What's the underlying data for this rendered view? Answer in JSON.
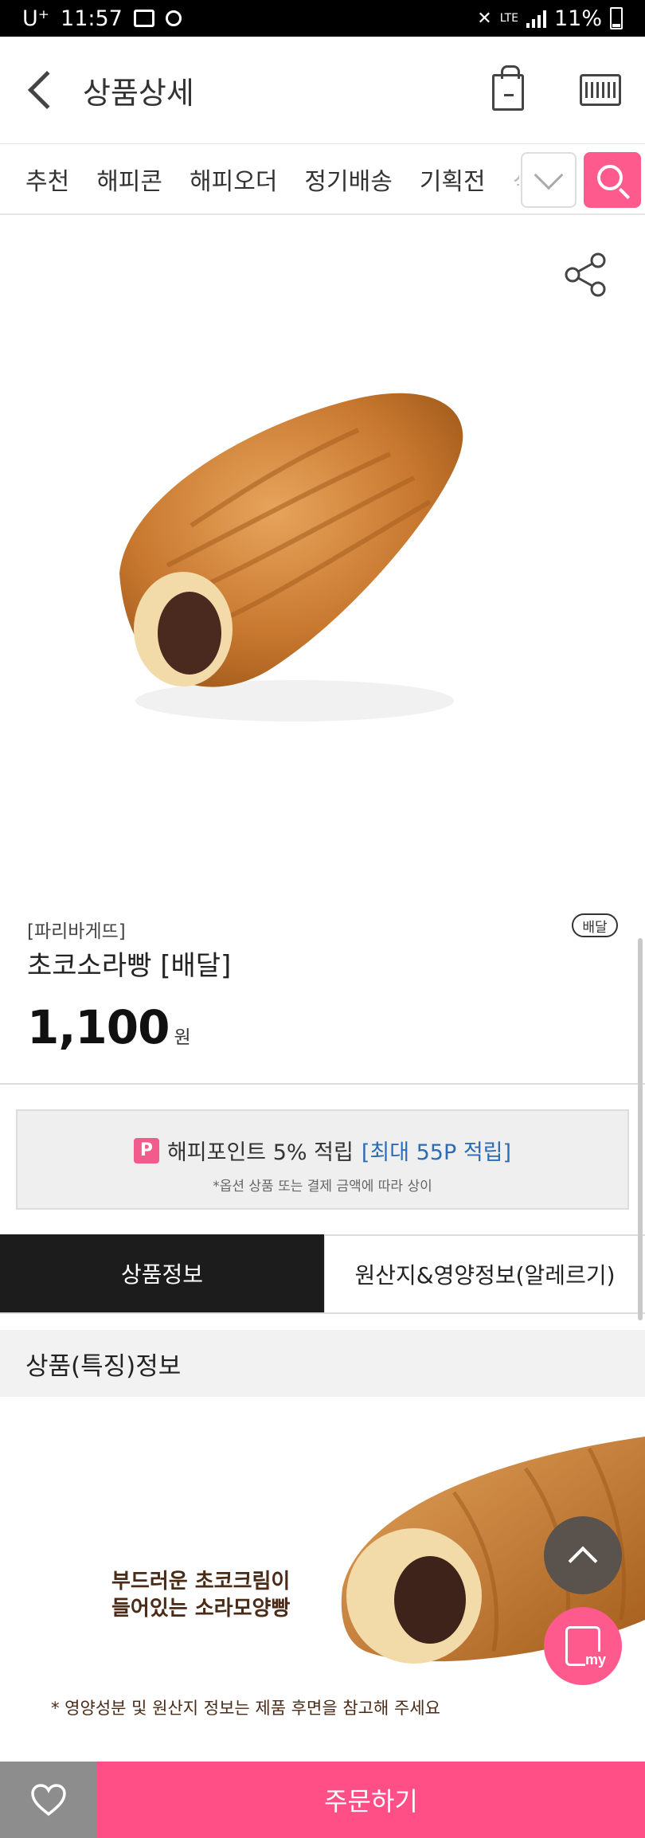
{
  "status_bar": {
    "carrier": "U⁺",
    "time": "11:57",
    "network": "LTE",
    "battery": "11%"
  },
  "header": {
    "title": "상품상세",
    "icons": [
      "back-icon",
      "shopping-bag-icon",
      "barcode-icon"
    ]
  },
  "category_nav": {
    "items": [
      "추천",
      "해피콘",
      "해피오더",
      "정기배송",
      "기획전",
      "식"
    ]
  },
  "product": {
    "brand": "[파리바게뜨]",
    "badge": "배달",
    "name": "초코소라빵 [배달]",
    "price": "1,100",
    "price_unit": "원"
  },
  "points": {
    "badge": "P",
    "text": "해피포인트 5% 적립",
    "max": "[최대 55P 적립]",
    "note": "*옵션 상품 또는 결제 금액에 따라 상이"
  },
  "tabs": [
    {
      "label": "상품정보",
      "active": true
    },
    {
      "label": "원산지&영양정보(알레르기)",
      "active": false
    }
  ],
  "detail": {
    "section_title": "상품(특징)정보",
    "tagline_1": "부드러운 초코크림이",
    "tagline_2": "들어있는 소라모양빵",
    "note": "* 영양성분 및 원산지 정보는 제품 후면을 참고해 주세요"
  },
  "fab": {
    "my_label": "my"
  },
  "bottom": {
    "order_label": "주문하기"
  },
  "colors": {
    "accent": "#ff4f86",
    "point_link": "#2d6cb5",
    "tab_active": "#1c1c1c"
  }
}
